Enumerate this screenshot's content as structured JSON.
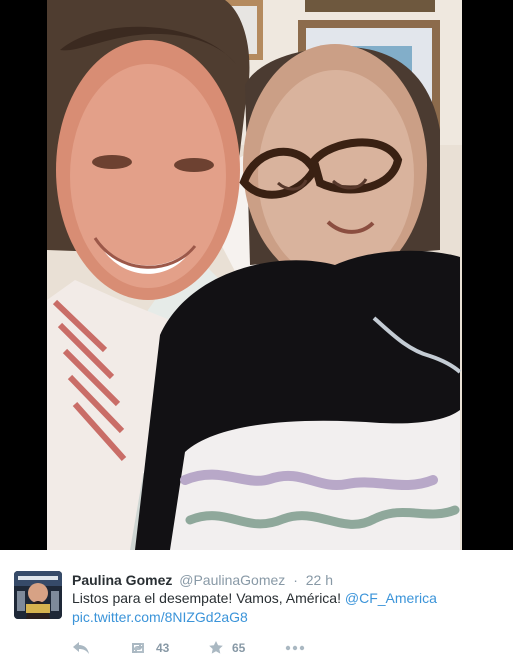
{
  "tweet": {
    "fullname": "Paulina Gomez",
    "username": "@PaulinaGomez",
    "separator": "·",
    "time": "22 h",
    "text_prefix": "Listos para el desempate! Vamos, América! ",
    "mention": "@CF_America",
    "link": "pic.twitter.com/8NIZGd2aG8"
  },
  "actions": {
    "reply_icon": "reply-icon",
    "retweet_icon": "retweet-icon",
    "retweet_count": "43",
    "favorite_icon": "star-icon",
    "favorite_count": "65",
    "more_icon": "more-dots-icon"
  },
  "colors": {
    "link": "#3b94d9",
    "secondary_text": "#8899a6",
    "icon": "#aab8c2",
    "primary_text": "#292f33"
  }
}
